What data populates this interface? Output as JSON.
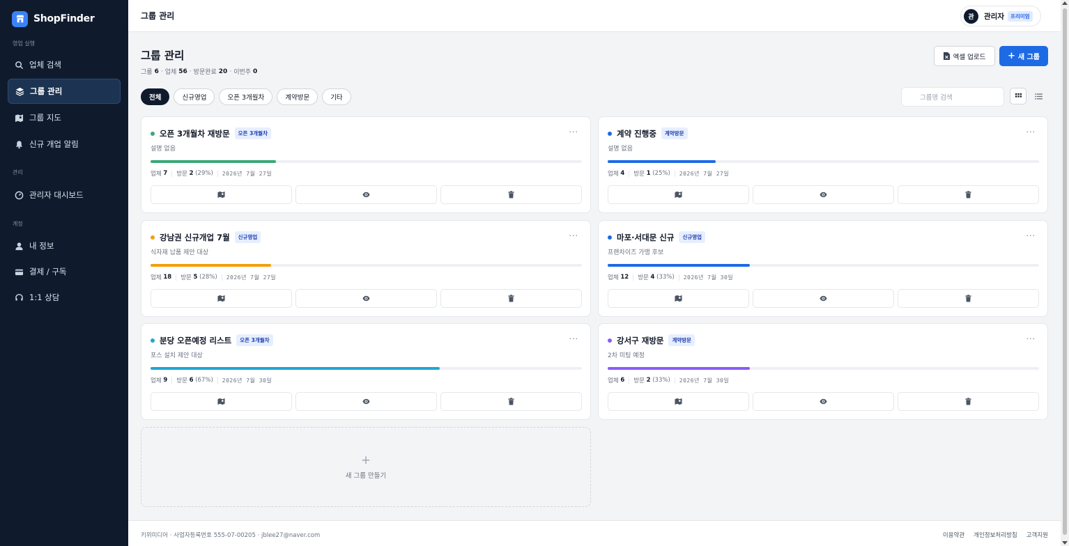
{
  "brand": {
    "name": "ShopFinder"
  },
  "sidebar": {
    "sections": [
      {
        "label": "영업 실행",
        "items": [
          {
            "label": "업체 검색",
            "icon": "search-icon",
            "active": false
          },
          {
            "label": "그룹 관리",
            "icon": "layers-icon",
            "active": true
          },
          {
            "label": "그룹 지도",
            "icon": "map-icon",
            "active": false
          },
          {
            "label": "신규 개업 알림",
            "icon": "bell-icon",
            "active": false
          }
        ]
      },
      {
        "label": "관리",
        "items": [
          {
            "label": "관리자 대시보드",
            "icon": "dashboard-icon",
            "active": false
          }
        ]
      },
      {
        "label": "계정",
        "items": [
          {
            "label": "내 정보",
            "icon": "user-icon",
            "active": false
          },
          {
            "label": "결제 / 구독",
            "icon": "credit-card-icon",
            "active": false
          },
          {
            "label": "1:1 상담",
            "icon": "headset-icon",
            "active": false
          }
        ]
      }
    ]
  },
  "topbar": {
    "title": "그룹 관리",
    "user": {
      "avatar": "관",
      "name": "관리자",
      "badge": "프리미엄"
    }
  },
  "page": {
    "title": "그룹 관리",
    "stats": {
      "groups_label": "그룹",
      "groups": "6",
      "shops_label": "업체",
      "shops": "56",
      "visited_label": "방문완료",
      "visited": "20",
      "week_label": "이번주",
      "week": "0",
      "separator": "·"
    },
    "excel_button": "엑셀 업로드",
    "new_group_button": "새 그룹",
    "filters": [
      "전체",
      "신규영업",
      "오픈 3개월차",
      "계약방문",
      "기타"
    ],
    "search_placeholder": "그룹명 검색"
  },
  "groups": [
    {
      "title": "오픈 3개월차 재방문",
      "tag": "오픈 3개월차",
      "desc": "설명 없음",
      "color": "#3aa876",
      "progress": 0.29,
      "shops_label": "업체",
      "shops": "7",
      "visits_label": "방문",
      "visits": "2",
      "pct": "(29%)",
      "date": "2026년 7월 27일"
    },
    {
      "title": "계약 진행중",
      "tag": "계약방문",
      "desc": "설명 없음",
      "color": "#1d6ae5",
      "progress": 0.25,
      "shops_label": "업체",
      "shops": "4",
      "visits_label": "방문",
      "visits": "1",
      "pct": "(25%)",
      "date": "2026년 7월 27일"
    },
    {
      "title": "강남권 신규개업 7월",
      "tag": "신규영업",
      "desc": "식자재 납품 제안 대상",
      "color": "#f59e0b",
      "progress": 0.28,
      "shops_label": "업체",
      "shops": "18",
      "visits_label": "방문",
      "visits": "5",
      "pct": "(28%)",
      "date": "2026년 7월 27일"
    },
    {
      "title": "마포·서대문 신규",
      "tag": "신규영업",
      "desc": "프랜차이즈 가맹 후보",
      "color": "#1d6ae5",
      "progress": 0.33,
      "shops_label": "업체",
      "shops": "12",
      "visits_label": "방문",
      "visits": "4",
      "pct": "(33%)",
      "date": "2026년 7월 30일"
    },
    {
      "title": "분당 오픈예정 리스트",
      "tag": "오픈 3개월차",
      "desc": "포스 설치 제안 대상",
      "color": "#1ea7d6",
      "progress": 0.67,
      "shops_label": "업체",
      "shops": "9",
      "visits_label": "방문",
      "visits": "6",
      "pct": "(67%)",
      "date": "2026년 7월 30일"
    },
    {
      "title": "강서구 재방문",
      "tag": "계약방문",
      "desc": "2차 미팅 예정",
      "color": "#8b5cf6",
      "progress": 0.33,
      "shops_label": "업체",
      "shops": "6",
      "visits_label": "방문",
      "visits": "2",
      "pct": "(33%)",
      "date": "2026년 7월 30일"
    }
  ],
  "card_menu": "···",
  "add_card": {
    "plus": "+",
    "label": "새 그룹 만들기"
  },
  "footer": {
    "company": "키위미디어 · 사업자등록번호 555-07-00205 · jblee27@naver.com",
    "links": [
      "이용약관",
      "개인정보처리방침",
      "고객지원"
    ]
  }
}
